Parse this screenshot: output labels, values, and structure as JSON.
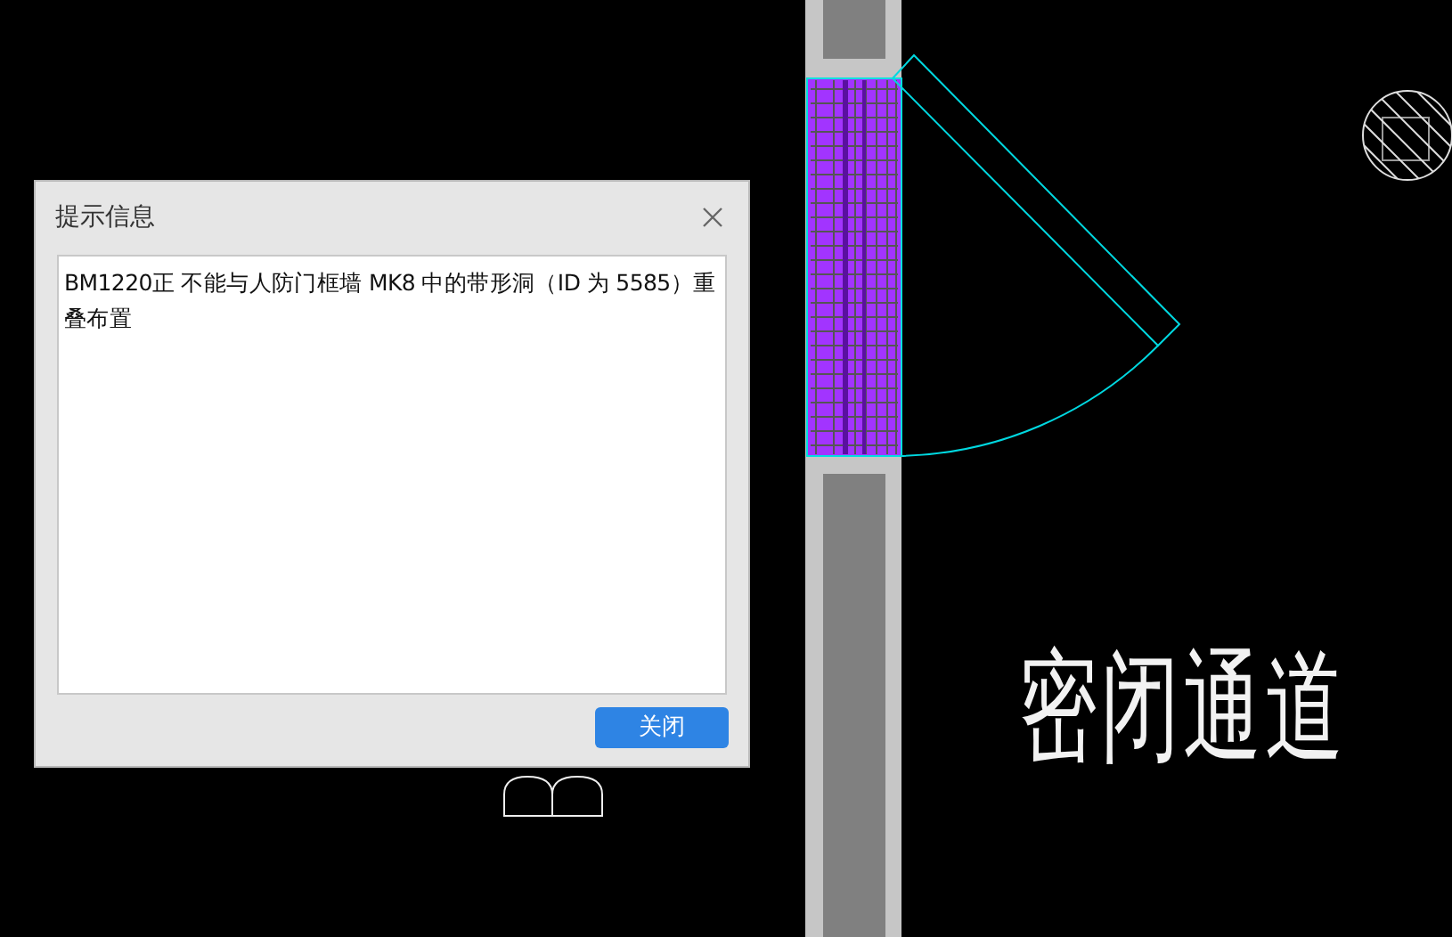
{
  "dialog": {
    "title": "提示信息",
    "message": "BM1220正 不能与人防门框墙 MK8 中的带形洞（ID 为 5585）重叠布置",
    "buttons": [
      {
        "label": "关闭",
        "kind": "primary"
      }
    ]
  },
  "drawing": {
    "room_label": "密闭通道"
  }
}
